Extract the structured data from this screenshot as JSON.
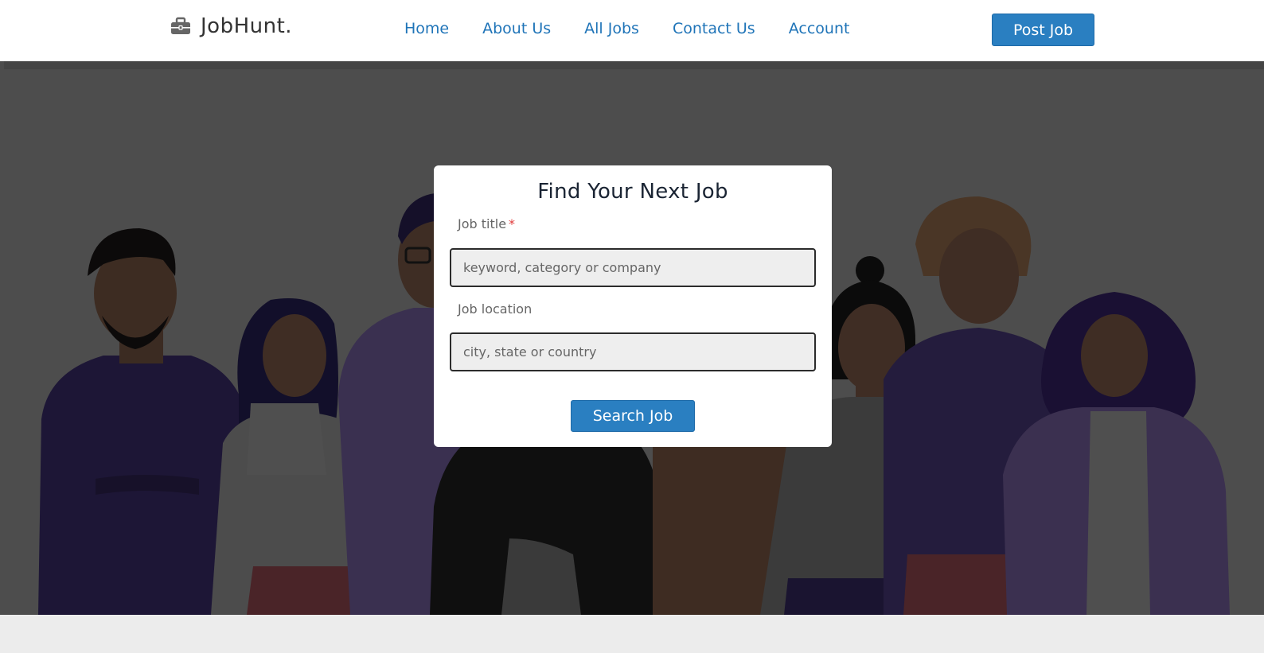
{
  "navbar": {
    "brand": "JobHunt.",
    "brand_icon": "briefcase-icon",
    "links": [
      "Home",
      "About Us",
      "All Jobs",
      "Contact Us",
      "Account"
    ],
    "post_button": "Post Job",
    "accent_color": "#2a7fc1",
    "link_color": "#1f74b8"
  },
  "hero": {
    "overlay_color": "#4d4d4d"
  },
  "search_card": {
    "title": "Find Your Next Job",
    "job_title_label": "Job title",
    "required_marker": "*",
    "job_title_placeholder": "keyword, category or company",
    "job_title_value": "",
    "location_label": "Job location",
    "location_placeholder": "city, state or country",
    "location_value": "",
    "search_button": "Search Job"
  }
}
